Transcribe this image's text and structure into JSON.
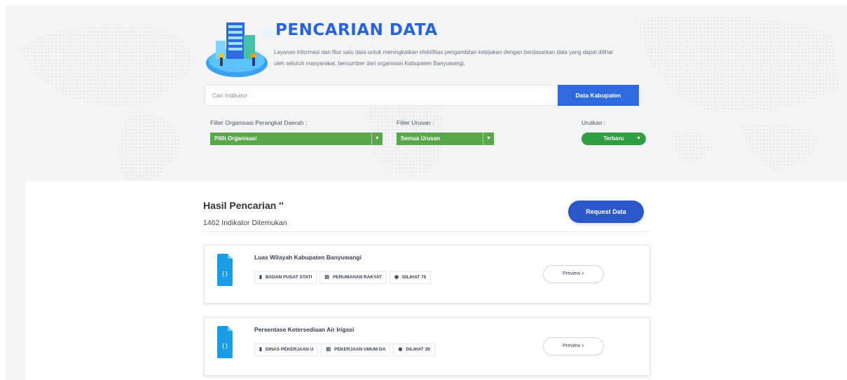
{
  "hero": {
    "title": "PENCARIAN DATA",
    "description": "Layanan informasi dan fitur satu data untuk meningkatkan efektifitas pengambilan kebijakan dengan berdasarkan data yang dapat dilihat oleh seluruh masyarakat, bersumber dari organisasi Kabupaten Banyuwangi."
  },
  "search": {
    "placeholder": "Cari Indikator",
    "button_label": "Data Kabupaten"
  },
  "filters": {
    "organisasi_label": "Filter Organisasi Perangkat Daerah :",
    "organisasi_value": "Pilih Organisasi",
    "urusan_label": "Filter Urusan :",
    "urusan_value": "Semua Urusan",
    "urutkan_label": "Urutkan :",
    "urutkan_value": "Terbaru"
  },
  "results": {
    "title": "Hasil Pencarian ''",
    "count": "1462 Indikator Ditemukan",
    "request_button": "Request Data",
    "items": [
      {
        "title": "Luas Wilayah Kabupaten Banyuwangi",
        "tags": [
          "BADAN PUSAT STATI",
          "PERUMAHAN RAKYAT",
          "DILIHAT 75"
        ],
        "preview": "Preview"
      },
      {
        "title": "Persentase Ketersediaan Air Irigasi",
        "tags": [
          "DINAS PEKERJAAN U",
          "PEKERJAAN UMUM DA",
          "DILIHAT 39"
        ],
        "preview": "Preview"
      }
    ]
  },
  "colors": {
    "primary": "#2f6adf",
    "green": "#5aa84b",
    "sort_green": "#2ea043",
    "file_icon": "#1a9be3"
  },
  "icons": {
    "file": "json-file-icon",
    "book": "book-icon",
    "eye": "eye-icon",
    "search": "search-icon",
    "caret": "caret-down-icon",
    "chevron": "chevron-down-icon"
  }
}
